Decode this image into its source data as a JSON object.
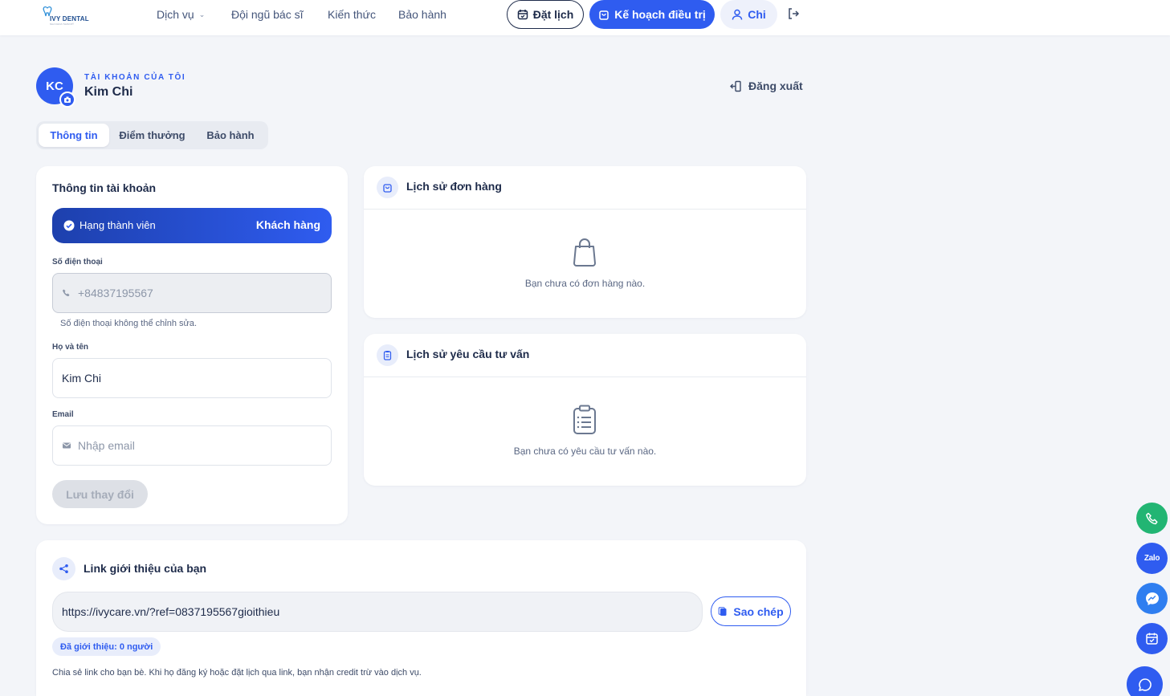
{
  "header": {
    "logo_text": "IVY DENTAL",
    "logo_tagline": "NHA KHOA THẨM MỸ",
    "nav": [
      {
        "label": "Dịch vụ"
      },
      {
        "label": "Đội ngũ bác sĩ"
      },
      {
        "label": "Kiến thức"
      },
      {
        "label": "Bảo hành"
      }
    ],
    "book_label": "Đặt lịch",
    "plan_label": "Kế hoạch điều trị",
    "user_label": "Chi"
  },
  "profile": {
    "initials": "KC",
    "section_label": "TÀI KHOẢN CỦA TÔI",
    "name": "Kim Chi",
    "logout_label": "Đăng xuất"
  },
  "tabs": [
    {
      "label": "Thông tin",
      "active": true
    },
    {
      "label": "Điểm thưởng",
      "active": false
    },
    {
      "label": "Bảo hành",
      "active": false
    }
  ],
  "account": {
    "title": "Thông tin tài khoản",
    "member_label": "Hạng thành viên",
    "member_value": "Khách hàng",
    "phone_label": "Số điện thoại",
    "phone_value": "+84837195567",
    "phone_hint": "Số điện thoại không thể chỉnh sửa.",
    "name_label": "Họ và tên",
    "name_value": "Kim Chi",
    "email_label": "Email",
    "email_placeholder": "Nhập email",
    "save_label": "Lưu thay đổi"
  },
  "orders": {
    "title": "Lịch sử đơn hàng",
    "empty": "Bạn chưa có đơn hàng nào."
  },
  "consults": {
    "title": "Lịch sử yêu cầu tư vấn",
    "empty": "Bạn chưa có yêu cầu tư vấn nào."
  },
  "referral": {
    "title": "Link giới thiệu của bạn",
    "link": "https://ivycare.vn/?ref=0837195567gioithieu",
    "copy_label": "Sao chép",
    "count_label": "Đã giới thiệu: 0 người",
    "note": "Chia sẻ link cho bạn bè. Khi họ đăng ký hoặc đặt lịch qua link, bạn nhận credit trừ vào dịch vụ."
  },
  "floating": {
    "zalo_label": "Zalo"
  },
  "colors": {
    "primary": "#2f5cf0",
    "member_gradient_start": "#1d40ad",
    "call_green": "#22b573",
    "text_dark": "#1e2b4a"
  }
}
